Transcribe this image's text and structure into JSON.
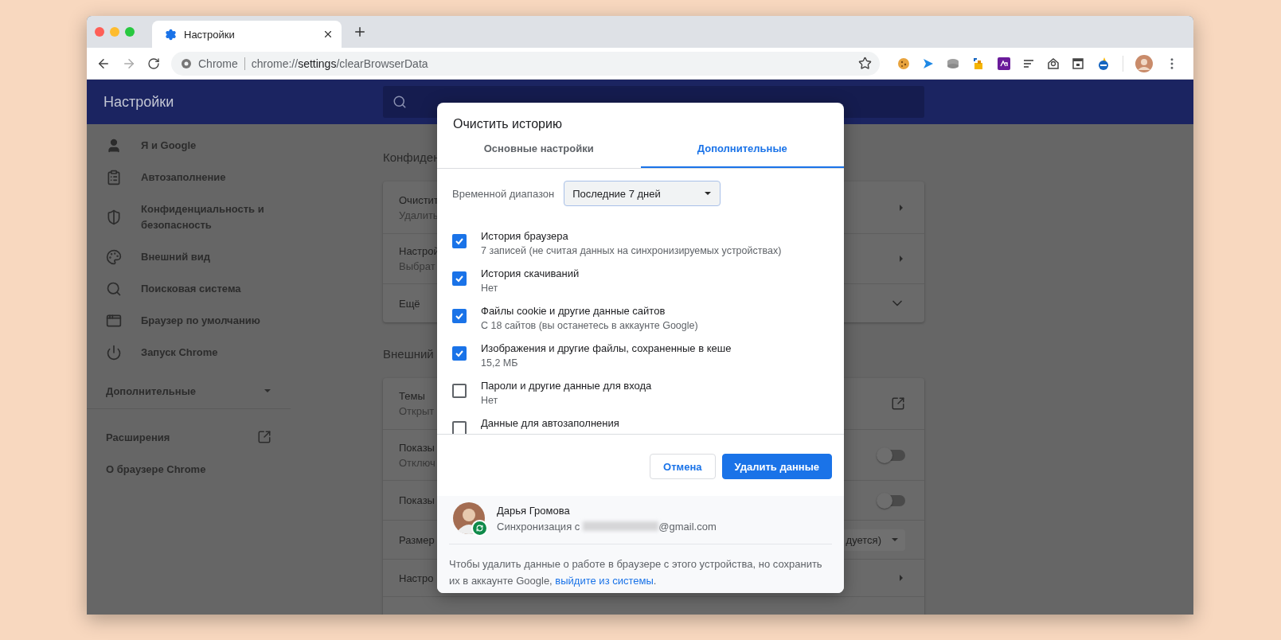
{
  "browser": {
    "tab": {
      "title": "Настройки"
    },
    "omnibox": {
      "site": "Chrome",
      "url_scheme": "chrome://",
      "url_host": "settings",
      "url_path": "/clearBrowserData"
    }
  },
  "settings": {
    "header": {
      "title": "Настройки"
    },
    "sidebar": {
      "items": [
        {
          "label": "Я и Google"
        },
        {
          "label": "Автозаполнение"
        },
        {
          "label": "Конфиденциальность и безопасность"
        },
        {
          "label": "Внешний вид"
        },
        {
          "label": "Поисковая система"
        },
        {
          "label": "Браузер по умолчанию"
        },
        {
          "label": "Запуск Chrome"
        }
      ],
      "advanced": {
        "label": "Дополнительные",
        "expanded": false
      },
      "links": [
        {
          "label": "Расширения",
          "kind": "external"
        },
        {
          "label": "О браузере Chrome",
          "kind": "plain"
        }
      ]
    },
    "sections": [
      {
        "heading": "Конфиден",
        "rows": [
          {
            "title": "Очистит",
            "subtitle": "Удалить",
            "kind": "arrow"
          },
          {
            "title": "Настрой",
            "subtitle": "Выбрат",
            "kind": "arrow"
          },
          {
            "title": "Ещё",
            "kind": "expand"
          }
        ]
      },
      {
        "heading": "Внешний",
        "rows": [
          {
            "title": "Темы",
            "subtitle": "Открыт",
            "kind": "external"
          },
          {
            "title": "Показы",
            "subtitle": "Отключ",
            "kind": "toggle",
            "on": false
          },
          {
            "title": "Показы",
            "kind": "toggle",
            "on": false
          },
          {
            "title": "Размер",
            "kind": "dropdown",
            "value": "дуется)"
          },
          {
            "title": "Настро",
            "kind": "arrow"
          },
          {
            "kind": "empty"
          }
        ]
      }
    ]
  },
  "dialog": {
    "title": "Очистить историю",
    "tabs": [
      {
        "label": "Основные настройки",
        "selected": false
      },
      {
        "label": "Дополнительные",
        "selected": true
      }
    ],
    "time_range": {
      "label": "Временной диапазон",
      "value": "Последние 7 дней"
    },
    "items": [
      {
        "title": "История браузера",
        "subtitle": "7 записей (не считая данных на синхронизируемых устройствах)",
        "checked": true
      },
      {
        "title": "История скачиваний",
        "subtitle": "Нет",
        "checked": true
      },
      {
        "title": "Файлы cookie и другие данные сайтов",
        "subtitle": "С 18 сайтов (вы останетесь в аккаунте Google)",
        "checked": true
      },
      {
        "title": "Изображения и другие файлы, сохраненные в кеше",
        "subtitle": "15,2 МБ",
        "checked": true
      },
      {
        "title": "Пароли и другие данные для входа",
        "subtitle": "Нет",
        "checked": false
      },
      {
        "title": "Данные для автозаполнения",
        "checked": false
      }
    ],
    "buttons": [
      {
        "label": "Отмена",
        "kind": "secondary"
      },
      {
        "label": "Удалить данные",
        "kind": "primary"
      }
    ],
    "account": {
      "name": "Дарья Громова",
      "sync_label": "Синхронизация с",
      "email_domain": "@gmail.com"
    },
    "note": {
      "text": "Чтобы удалить данные о работе в браузере с этого устройства, но сохранить их в аккаунте Google,",
      "link": "выйдите из системы",
      "end": "."
    }
  }
}
